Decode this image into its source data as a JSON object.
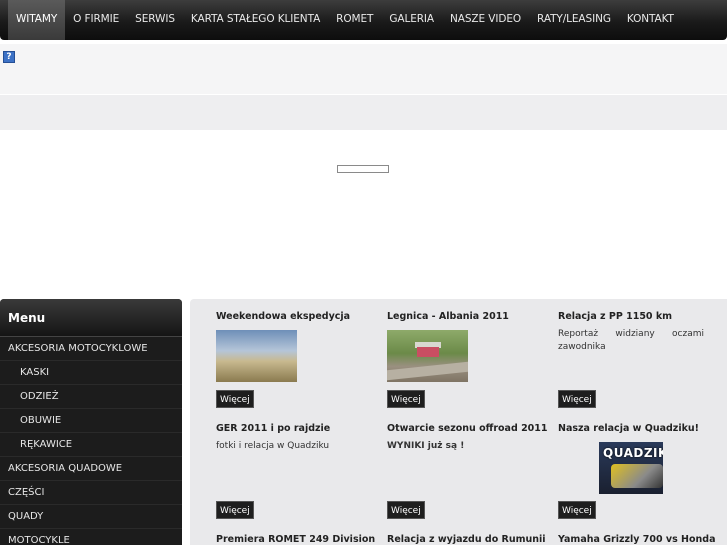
{
  "nav": {
    "items": [
      {
        "label": "WITAMY",
        "active": true
      },
      {
        "label": "O FIRMIE"
      },
      {
        "label": "SERWIS"
      },
      {
        "label": "KARTA STAŁEGO KLIENTA"
      },
      {
        "label": "ROMET"
      },
      {
        "label": "GALERIA"
      },
      {
        "label": "NASZE VIDEO"
      },
      {
        "label": "RATY/LEASING"
      },
      {
        "label": "KONTAKT"
      }
    ]
  },
  "help_icon": "?",
  "sidebar": {
    "title": "Menu",
    "items": [
      {
        "label": "AKCESORIA MOTOCYKLOWE"
      },
      {
        "label": "KASKI",
        "sub": true
      },
      {
        "label": "ODZIEŻ",
        "sub": true
      },
      {
        "label": "OBUWIE",
        "sub": true
      },
      {
        "label": "RĘKAWICE",
        "sub": true
      },
      {
        "label": "AKCESORIA QUADOWE"
      },
      {
        "label": "CZĘŚCI"
      },
      {
        "label": "QUADY"
      },
      {
        "label": "MOTOCYKLE"
      }
    ]
  },
  "cards": {
    "row1": [
      {
        "title": "Weekendowa ekspedycja",
        "more": "Więcej"
      },
      {
        "title": "Legnica - Albania 2011",
        "more": "Więcej"
      },
      {
        "title": "Relacja z PP 1150 km",
        "text": "Reportaż widziany oczami zawodnika",
        "more": "Więcej"
      }
    ],
    "row2": [
      {
        "title": "GER 2011 i po rajdzie",
        "text": "fotki i relacja w Quadziku",
        "more": "Więcej"
      },
      {
        "title": "Otwarcie sezonu offroad 2011",
        "text": "WYNIKI już są !",
        "more": "Więcej"
      },
      {
        "title": "Nasza relacja w Quadziku!",
        "logo": "QUADZIK",
        "more": "Więcej"
      }
    ],
    "row3": [
      {
        "title": "Premiera ROMET 249 Division"
      },
      {
        "title": "Relacja z wyjazdu do Rumunii"
      },
      {
        "title": "Yamaha Grizzly 700 vs Honda"
      }
    ]
  }
}
